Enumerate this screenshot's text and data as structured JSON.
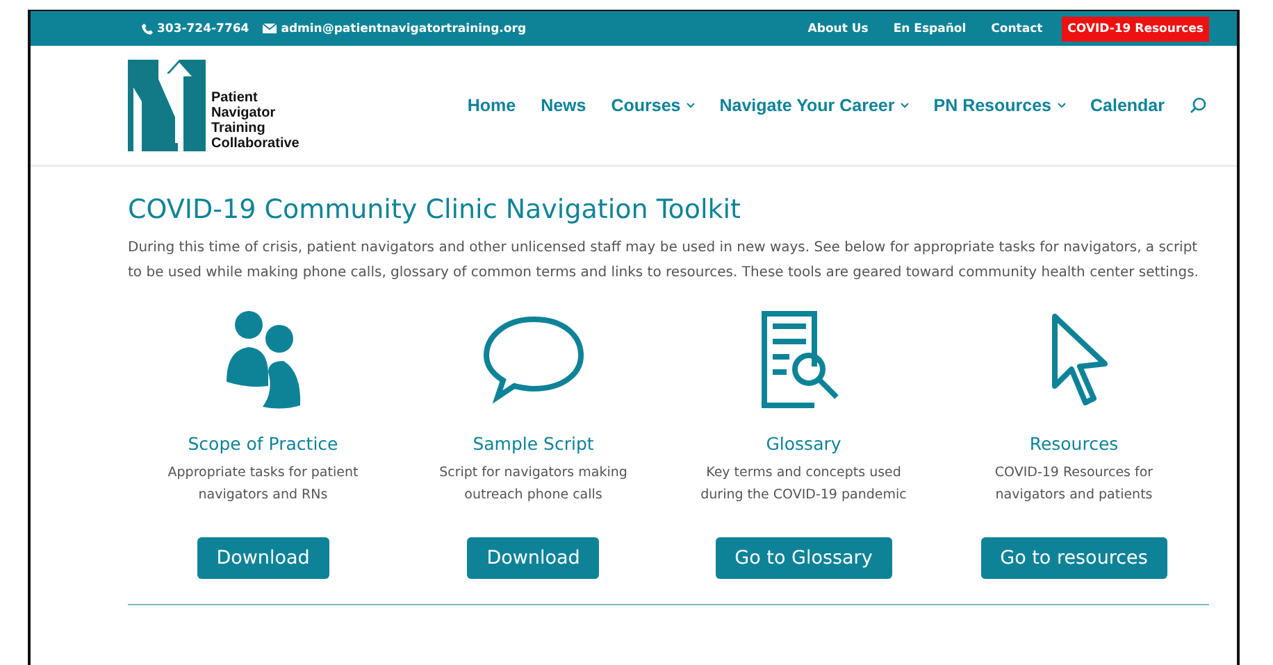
{
  "top_bar": {
    "phone": "303-724-7764",
    "email": "admin@patientnavigatortraining.org",
    "links": [
      {
        "label": "About Us",
        "highlighted": false
      },
      {
        "label": "En Español",
        "highlighted": false
      },
      {
        "label": "Contact",
        "highlighted": false
      },
      {
        "label": "COVID-19 Resources",
        "highlighted": true
      }
    ]
  },
  "logo": {
    "lines": [
      "Patient",
      "Navigator",
      "Training",
      "Collaborative"
    ]
  },
  "nav": [
    {
      "label": "Home",
      "dropdown": false
    },
    {
      "label": "News",
      "dropdown": false
    },
    {
      "label": "Courses",
      "dropdown": true
    },
    {
      "label": "Navigate Your Career",
      "dropdown": true
    },
    {
      "label": "PN Resources",
      "dropdown": true
    },
    {
      "label": "Calendar",
      "dropdown": false
    }
  ],
  "heading": "COVID-19 Community Clinic Navigation Toolkit",
  "intro": "During this time of crisis, patient navigators and other unlicensed staff may be used in new ways. See below for appropriate tasks for navigators, a script to be used while making phone calls, glossary of common terms and links to resources. These tools are geared toward community health center settings.",
  "cards": [
    {
      "kind": "people",
      "title": "Scope of Practice",
      "text": "Appropriate tasks for patient navigators and RNs",
      "button": "Download"
    },
    {
      "kind": "speech",
      "title": "Sample Script",
      "text": "Script for navigators making outreach phone calls",
      "button": "Download"
    },
    {
      "kind": "document",
      "title": "Glossary",
      "text": "Key terms and concepts used during the COVID-19 pandemic",
      "button": "Go to Glossary"
    },
    {
      "kind": "cursor",
      "title": "Resources",
      "text": "COVID-19 Resources for navigators and patients",
      "button": "Go to resources"
    }
  ]
}
